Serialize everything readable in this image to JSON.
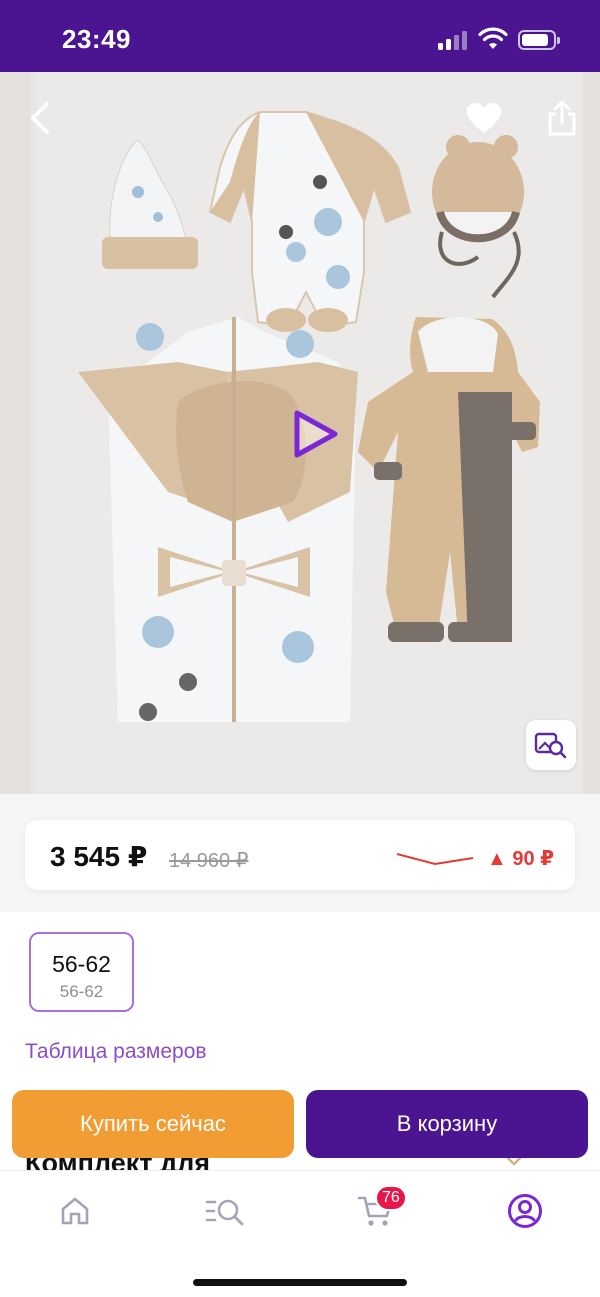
{
  "status_bar": {
    "time": "23:49"
  },
  "gallery": {
    "icons": [
      "chevron-left-icon",
      "heart-icon",
      "share-icon",
      "play-icon",
      "image-search-icon"
    ]
  },
  "price": {
    "current": "3 545 ₽",
    "old": "14 960 ₽",
    "change": "▲ 90 ₽",
    "change_color": "#e53935"
  },
  "sizes": [
    {
      "label": "56-62",
      "sub_label": "56-62"
    }
  ],
  "size_table_link": "Таблица размеров",
  "product_title": "Комплект для",
  "actions": {
    "buy_now": "Купить сейчас",
    "add_to_cart": "В корзину"
  },
  "bottom_nav": {
    "items": [
      "home-icon",
      "catalog-search-icon",
      "cart-icon",
      "profile-icon"
    ],
    "cart_count": "76"
  },
  "colors": {
    "brand": "#4b1591",
    "accent_orange": "#f29d33",
    "link": "#8b4ec9",
    "badge": "#e8174b"
  }
}
